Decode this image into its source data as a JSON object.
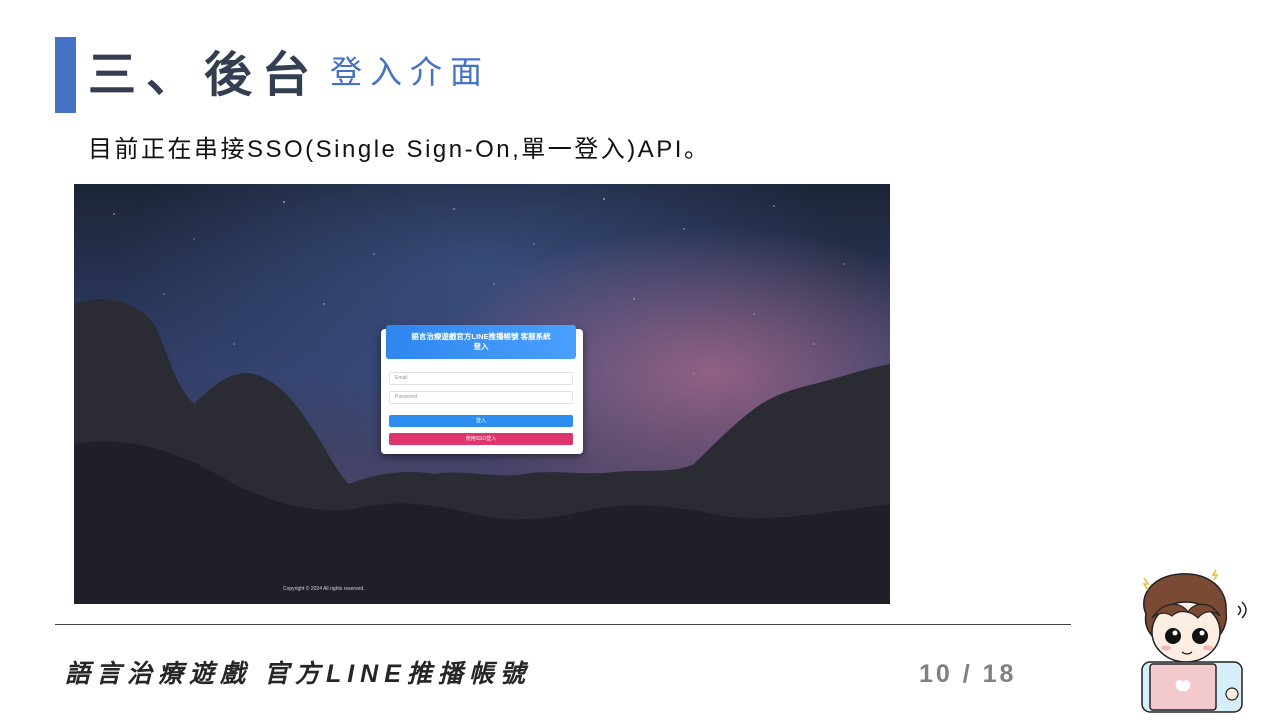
{
  "slide": {
    "title": "三、後台",
    "subtitle": "登入介面",
    "description": "目前正在串接SSO(Single Sign-On,單一登入)API。",
    "footer_title": "語言治療遊戲 官方LINE推播帳號",
    "page_number": "10 / 18",
    "accent_color": "#4472c4"
  },
  "screenshot": {
    "card_title_line1": "語言治療遊戲官方LINE推播帳號 客服系統",
    "card_title_line2": "登入",
    "email_placeholder": "Email",
    "password_placeholder": "Password",
    "login_button": "登入",
    "sso_button": "使用SSO登入",
    "copyright": "Copyright © 2024 All rights reserved.",
    "primary_color": "#2d8ef0",
    "sso_color": "#e0346f"
  },
  "icons": {
    "mascot": "cartoon-boy-with-laptop-icon"
  }
}
